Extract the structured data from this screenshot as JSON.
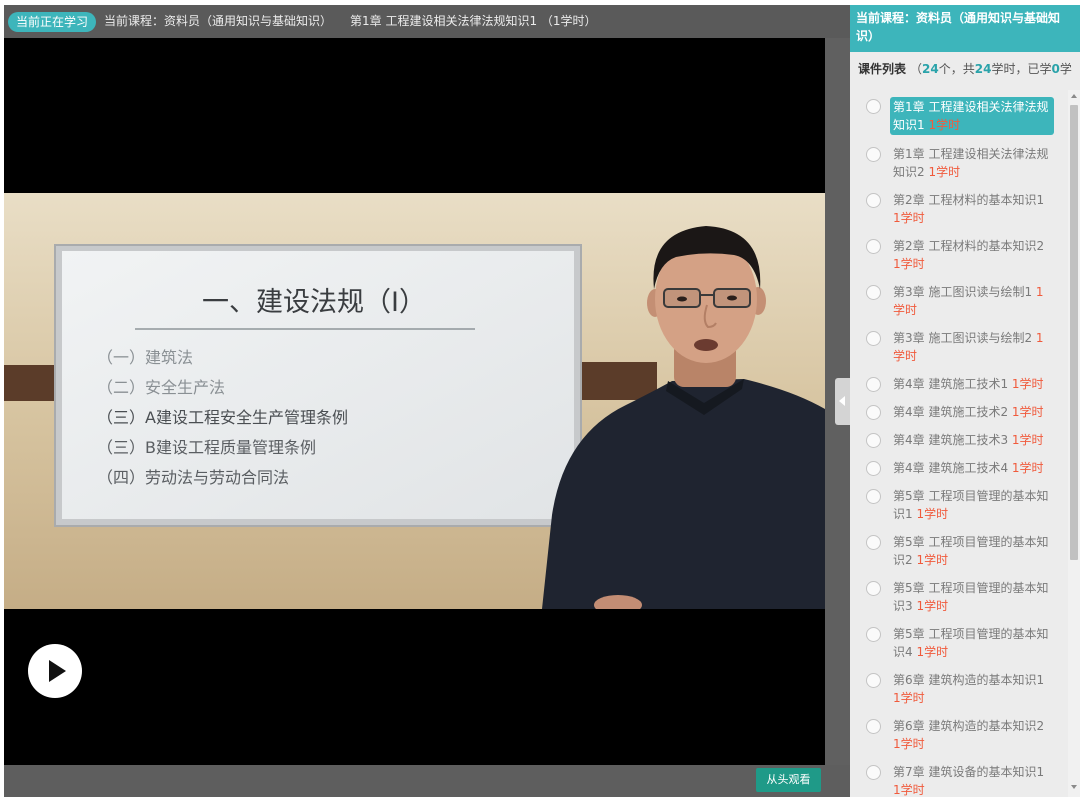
{
  "top_bar": {
    "badge": "当前正在学习",
    "course": "当前课程：资料员（通用知识与基础知识）",
    "chapter": "第1章 工程建设相关法律法规知识1 （1学时）"
  },
  "video": {
    "slide_title": "一、建设法规（I）",
    "slide_items": [
      "（一）建筑法",
      "（二）安全生产法",
      "（三）A建设工程安全生产管理条例",
      "（三）B建设工程质量管理条例",
      "（四）劳动法与劳动合同法"
    ],
    "play_icon": "play-icon",
    "replay_button": "从头观看"
  },
  "sidebar": {
    "header": "当前课程：资料员（通用知识与基础知识）",
    "list_label": "课件列表",
    "summary": {
      "open": "（",
      "count": "24",
      "count_unit": "个，共",
      "hours": "24",
      "hours_unit": "学时，已学",
      "learned": "0",
      "learned_unit": "学"
    },
    "items": [
      {
        "title": "第1章 工程建设相关法律法规知识1",
        "hours": "1学时",
        "active": true
      },
      {
        "title": "第1章 工程建设相关法律法规知识2",
        "hours": "1学时"
      },
      {
        "title": "第2章 工程材料的基本知识1",
        "hours": "1学时"
      },
      {
        "title": "第2章 工程材料的基本知识2",
        "hours": "1学时"
      },
      {
        "title": "第3章 施工图识读与绘制1",
        "hours": "1学时"
      },
      {
        "title": "第3章 施工图识读与绘制2",
        "hours": "1学时"
      },
      {
        "title": "第4章 建筑施工技术1",
        "hours": "1学时"
      },
      {
        "title": "第4章 建筑施工技术2",
        "hours": "1学时"
      },
      {
        "title": "第4章 建筑施工技术3",
        "hours": "1学时"
      },
      {
        "title": "第4章 建筑施工技术4",
        "hours": "1学时"
      },
      {
        "title": "第5章 工程项目管理的基本知识1",
        "hours": "1学时"
      },
      {
        "title": "第5章 工程项目管理的基本知识2",
        "hours": "1学时"
      },
      {
        "title": "第5章 工程项目管理的基本知识3",
        "hours": "1学时"
      },
      {
        "title": "第5章 工程项目管理的基本知识4",
        "hours": "1学时"
      },
      {
        "title": "第6章 建筑构造的基本知识1",
        "hours": "1学时"
      },
      {
        "title": "第6章 建筑构造的基本知识2",
        "hours": "1学时"
      },
      {
        "title": "第7章 建筑设备的基本知识1",
        "hours": "1学时"
      }
    ]
  },
  "colors": {
    "accent": "#3db5bb",
    "hours_text": "#f05a3c",
    "replay_button": "#1f9a88",
    "bar_gray": "#5a5a5a"
  }
}
